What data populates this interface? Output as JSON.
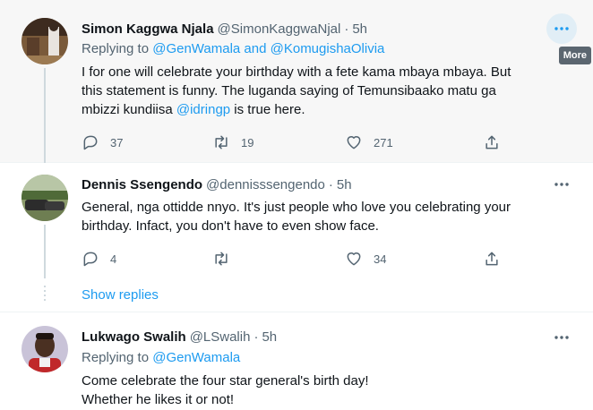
{
  "tweets": [
    {
      "name": "Simon Kaggwa Njala",
      "handle": "@SimonKaggwaNjal",
      "dot": "·",
      "time": "5h",
      "replying_prefix": "Replying to ",
      "replying_to": "@GenWamala and @KomugishaOlivia",
      "text_lines": [
        "I for one will celebrate your birthday with a fete kama mbaya mbaya.  But",
        "this statement is funny. The luganda saying of Temunsibaako matu ga"
      ],
      "text_line3_pre": "mbizzi kundiisa ",
      "text_line3_mention": "@idringp",
      "text_line3_post": " is true here.",
      "replies": "37",
      "retweets": "19",
      "likes": "271",
      "more_tooltip": "More"
    },
    {
      "name": "Dennis Ssengendo",
      "handle": "@dennisssengendo",
      "dot": "·",
      "time": "5h",
      "text_lines": [
        "General, nga ottidde nnyo. It's just people who love you celebrating your",
        "birthday. Infact, you don't have to even show face."
      ],
      "replies": "4",
      "retweets": "",
      "likes": "34",
      "show_replies": "Show replies"
    },
    {
      "name": "Lukwago Swalih",
      "handle": "@LSwalih",
      "dot": "·",
      "time": "5h",
      "replying_prefix": "Replying to ",
      "replying_to": "@GenWamala",
      "text_lines": [
        "Come celebrate the four star general's birth day!",
        "Whether he likes it or not!"
      ]
    }
  ],
  "icons": {
    "reply": "reply-icon",
    "retweet": "retweet-icon",
    "like": "heart-icon",
    "share": "share-icon",
    "more": "more-dots-icon"
  },
  "colors": {
    "accent": "#1d9bf0",
    "secondary_text": "#536471",
    "hover_bg": "#f7f7f7"
  }
}
